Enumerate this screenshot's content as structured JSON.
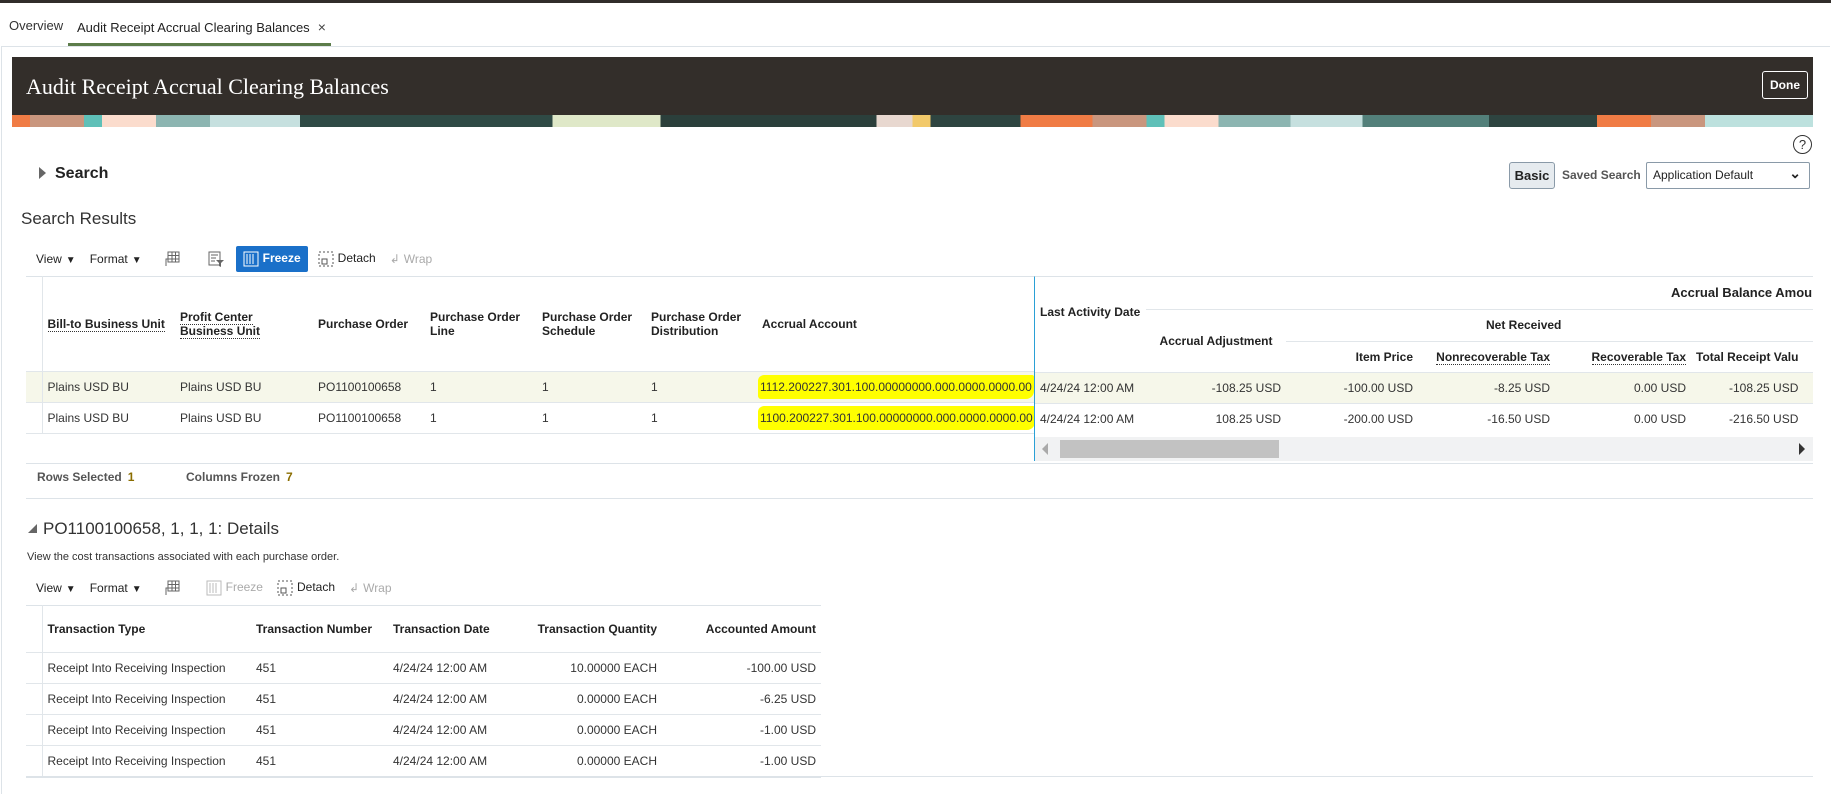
{
  "tabs": [
    {
      "label": "Overview"
    },
    {
      "label": "Audit Receipt Accrual Clearing Balances",
      "close": "×"
    }
  ],
  "header": {
    "title": "Audit Receipt Accrual Clearing Balances",
    "done_label": "Done"
  },
  "help": "?",
  "search": {
    "label": "Search",
    "basic_label": "Basic",
    "saved_search_label": "Saved Search",
    "saved_search_value": "Application Default"
  },
  "results": {
    "title": "Search Results",
    "toolbar": {
      "view": "View",
      "format": "Format",
      "freeze": "Freeze",
      "detach": "Detach",
      "wrap": "Wrap"
    },
    "headers": {
      "bill_to": "Bill-to Business Unit",
      "profit_center": "Profit Center Business Unit",
      "po": "Purchase Order",
      "po_line": "Purchase Order Line",
      "po_schedule": "Purchase Order Schedule",
      "po_distribution": "Purchase Order Distribution",
      "accrual_account": "Accrual Account",
      "last_activity": "Last Activity Date",
      "group_balance": "Accrual Balance Amou",
      "accrual_adjustment": "Accrual Adjustment",
      "net_received": "Net Received",
      "item_price": "Item Price",
      "nonrec_tax": "Nonrecoverable Tax",
      "rec_tax": "Recoverable Tax",
      "total_receipt": "Total Receipt Valu"
    },
    "rows": [
      {
        "bill_to": "Plains USD BU",
        "profit_center": "Plains USD BU",
        "po": "PO1100100658",
        "line": "1",
        "schedule": "1",
        "distribution": "1",
        "account": "1112.200227.301.100.00000000.000.0000.0000.00",
        "date": "4/24/24 12:00 AM",
        "adjustment": "-108.25 USD",
        "item_price": "-100.00 USD",
        "nonrec": "-8.25 USD",
        "rec": "0.00 USD",
        "total": "-108.25 USD"
      },
      {
        "bill_to": "Plains USD BU",
        "profit_center": "Plains USD BU",
        "po": "PO1100100658",
        "line": "1",
        "schedule": "1",
        "distribution": "1",
        "account": "1100.200227.301.100.00000000.000.0000.0000.00",
        "date": "4/24/24 12:00 AM",
        "adjustment": "108.25 USD",
        "item_price": "-200.00 USD",
        "nonrec": "-16.50 USD",
        "rec": "0.00 USD",
        "total": "-216.50 USD"
      }
    ],
    "rows_selected_label": "Rows Selected",
    "rows_selected": "1",
    "columns_frozen_label": "Columns Frozen",
    "columns_frozen": "7"
  },
  "details": {
    "title": "PO1100100658, 1, 1, 1: Details",
    "description": "View the cost transactions associated with each purchase order.",
    "toolbar": {
      "view": "View",
      "format": "Format",
      "freeze": "Freeze",
      "detach": "Detach",
      "wrap": "Wrap"
    },
    "headers": {
      "type": "Transaction Type",
      "number": "Transaction Number",
      "date": "Transaction Date",
      "quantity": "Transaction Quantity",
      "amount": "Accounted Amount"
    },
    "rows": [
      {
        "type": "Receipt Into Receiving Inspection",
        "number": "451",
        "date": "4/24/24 12:00 AM",
        "quantity": "10.00000 EACH",
        "amount": "-100.00 USD"
      },
      {
        "type": "Receipt Into Receiving Inspection",
        "number": "451",
        "date": "4/24/24 12:00 AM",
        "quantity": "0.00000 EACH",
        "amount": "-6.25 USD"
      },
      {
        "type": "Receipt Into Receiving Inspection",
        "number": "451",
        "date": "4/24/24 12:00 AM",
        "quantity": "0.00000 EACH",
        "amount": "-1.00 USD"
      },
      {
        "type": "Receipt Into Receiving Inspection",
        "number": "451",
        "date": "4/24/24 12:00 AM",
        "quantity": "0.00000 EACH",
        "amount": "-1.00 USD"
      }
    ]
  }
}
